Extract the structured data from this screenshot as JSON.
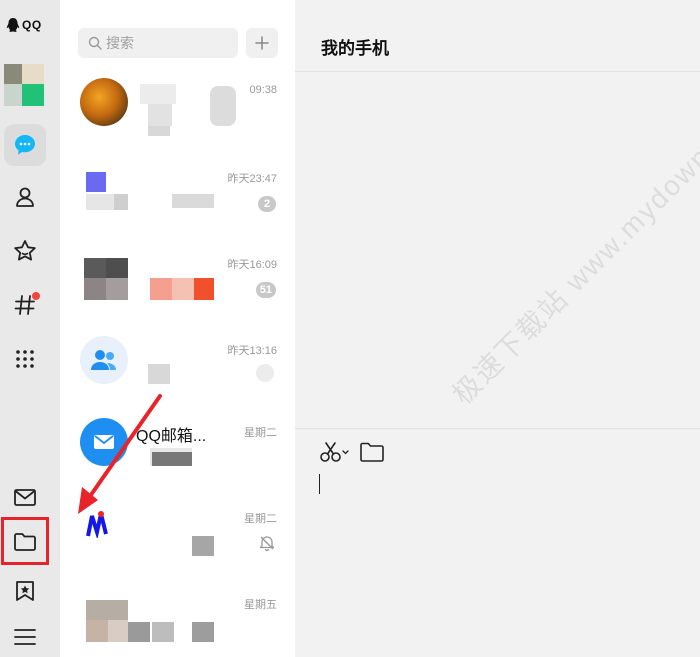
{
  "app": {
    "logo_text": "QQ"
  },
  "search": {
    "placeholder": "搜索"
  },
  "conversations": [
    {
      "time": "09:38",
      "badge": ""
    },
    {
      "time": "昨天23:47",
      "badge": "2"
    },
    {
      "time": "昨天16:09",
      "badge": "51"
    },
    {
      "time": "昨天13:16",
      "badge": ""
    },
    {
      "name": "QQ邮箱...",
      "time": "星期二",
      "badge": ""
    },
    {
      "time": "星期二",
      "badge": ""
    },
    {
      "time": "星期五",
      "badge": ""
    }
  ],
  "main": {
    "title": "我的手机"
  },
  "watermark": "极速下载站 www.mydown.com",
  "colors": {
    "accent": "#12b7f5",
    "highlight": "#e4242a",
    "badge": "#c8c8c8"
  }
}
